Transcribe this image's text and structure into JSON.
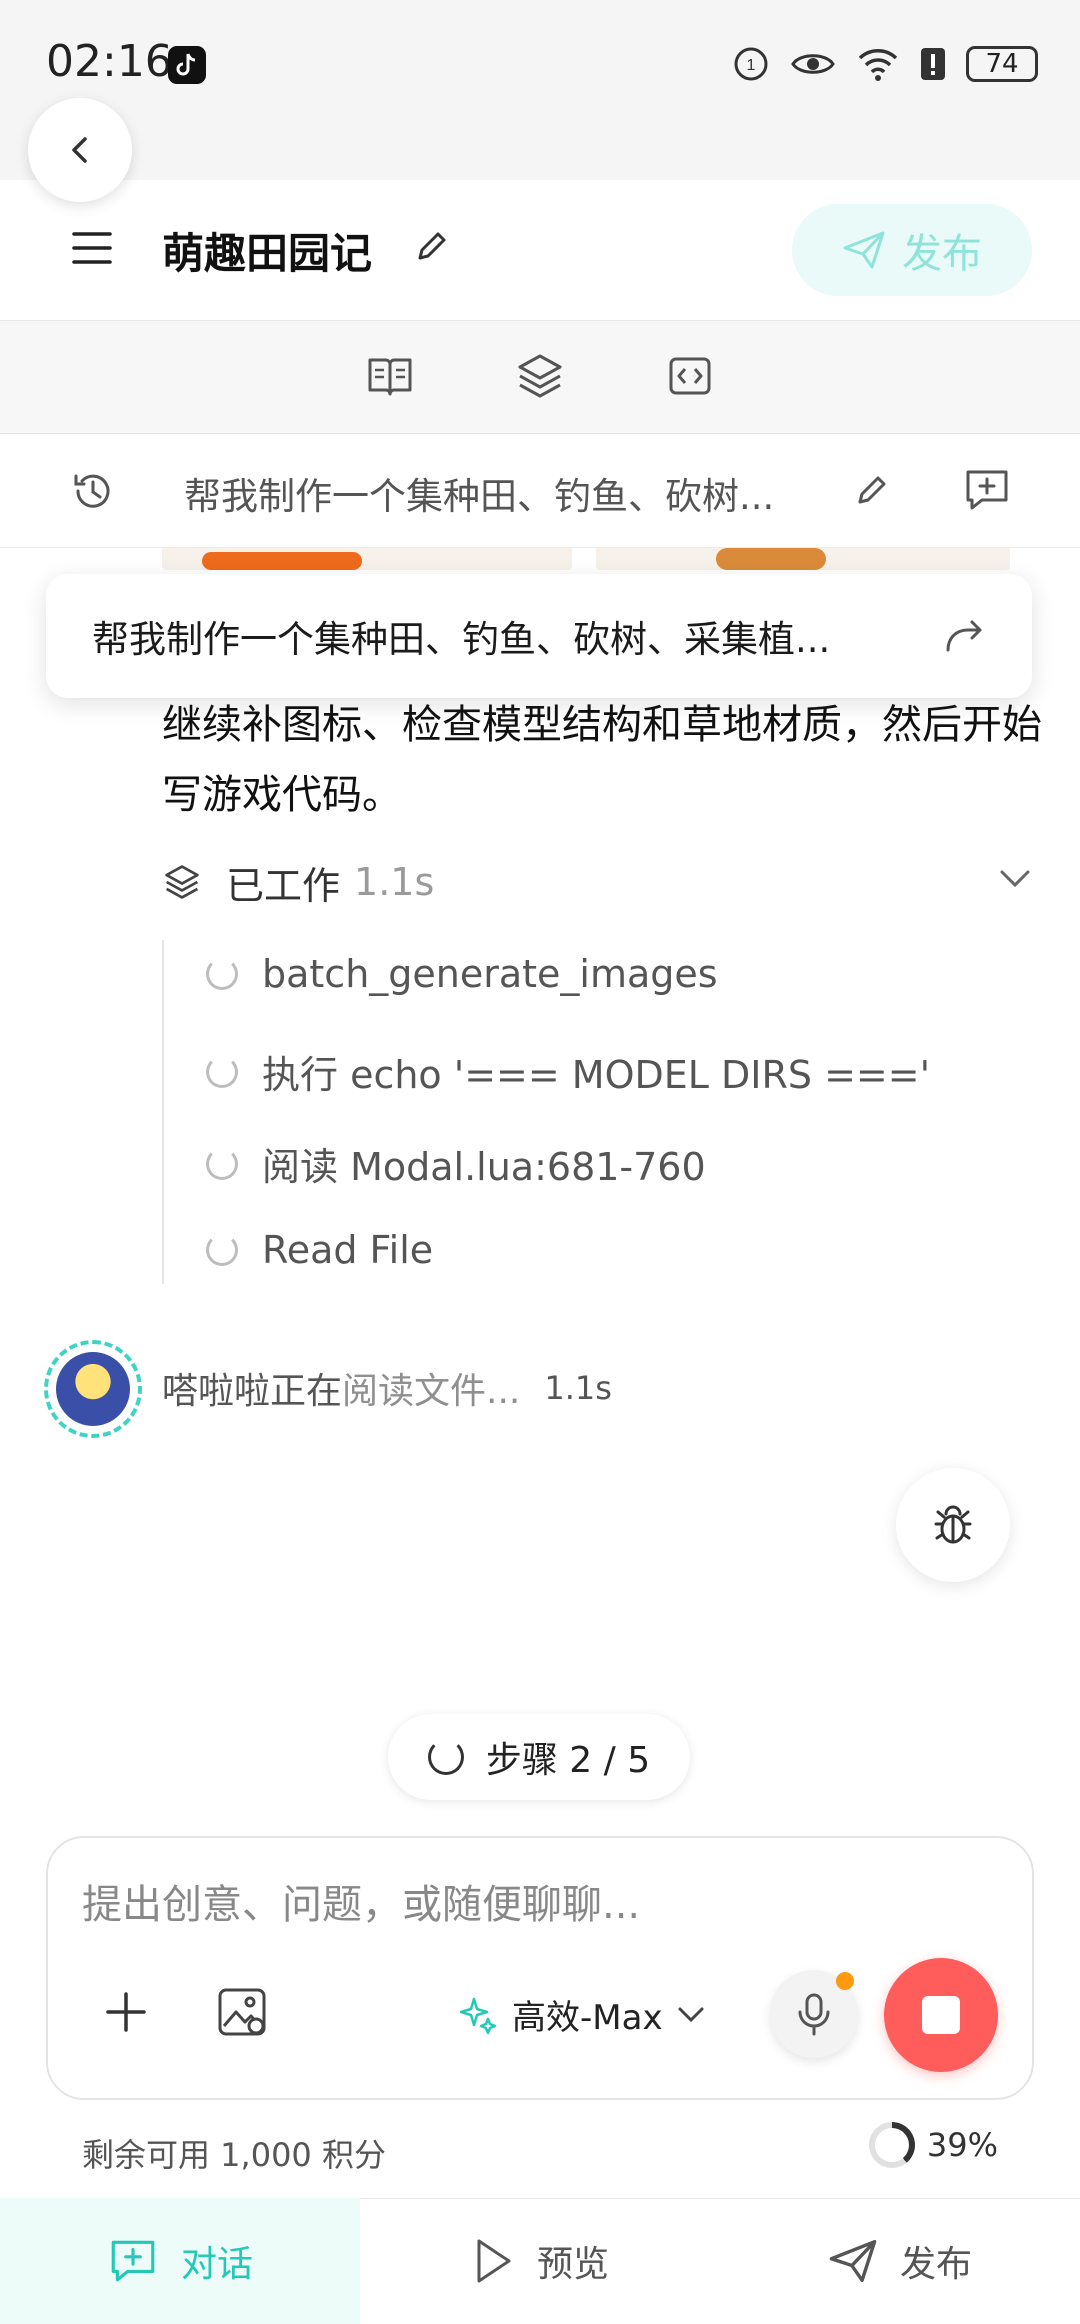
{
  "status_bar": {
    "time": "02:16",
    "battery": "74"
  },
  "header": {
    "title": "萌趣田园记",
    "publish_label": "发布"
  },
  "session": {
    "title": "帮我制作一个集种田、钓鱼、砍树..."
  },
  "popup": {
    "text": "帮我制作一个集种田、钓鱼、砍树、采集植..."
  },
  "message": {
    "body": "继续补图标、检查模型结构和草地材质，然后开始写游戏代码。",
    "worked_label": "已工作",
    "worked_duration": "1.1s",
    "tasks": [
      {
        "label": "batch_generate_images"
      },
      {
        "label": "执行 echo '=== MODEL DIRS ==='"
      },
      {
        "label": "阅读 Modal.lua:681-760"
      },
      {
        "label": "Read File"
      }
    ]
  },
  "agent": {
    "status_prefix": "嗒啦啦正在",
    "status_action": "阅读文件...",
    "duration": "1.1s"
  },
  "progress": {
    "steps_label": "步骤 2 / 5"
  },
  "composer": {
    "placeholder": "提出创意、问题，或随便聊聊...",
    "model_label": "高效-Max"
  },
  "footer": {
    "credits": "剩余可用 1,000 积分",
    "percent": "39%"
  },
  "nav": {
    "chat": "对话",
    "preview": "预览",
    "publish": "发布"
  },
  "colors": {
    "accent": "#23c9b6",
    "stop": "#ff5c5c",
    "mic_dot": "#ff9a10"
  }
}
